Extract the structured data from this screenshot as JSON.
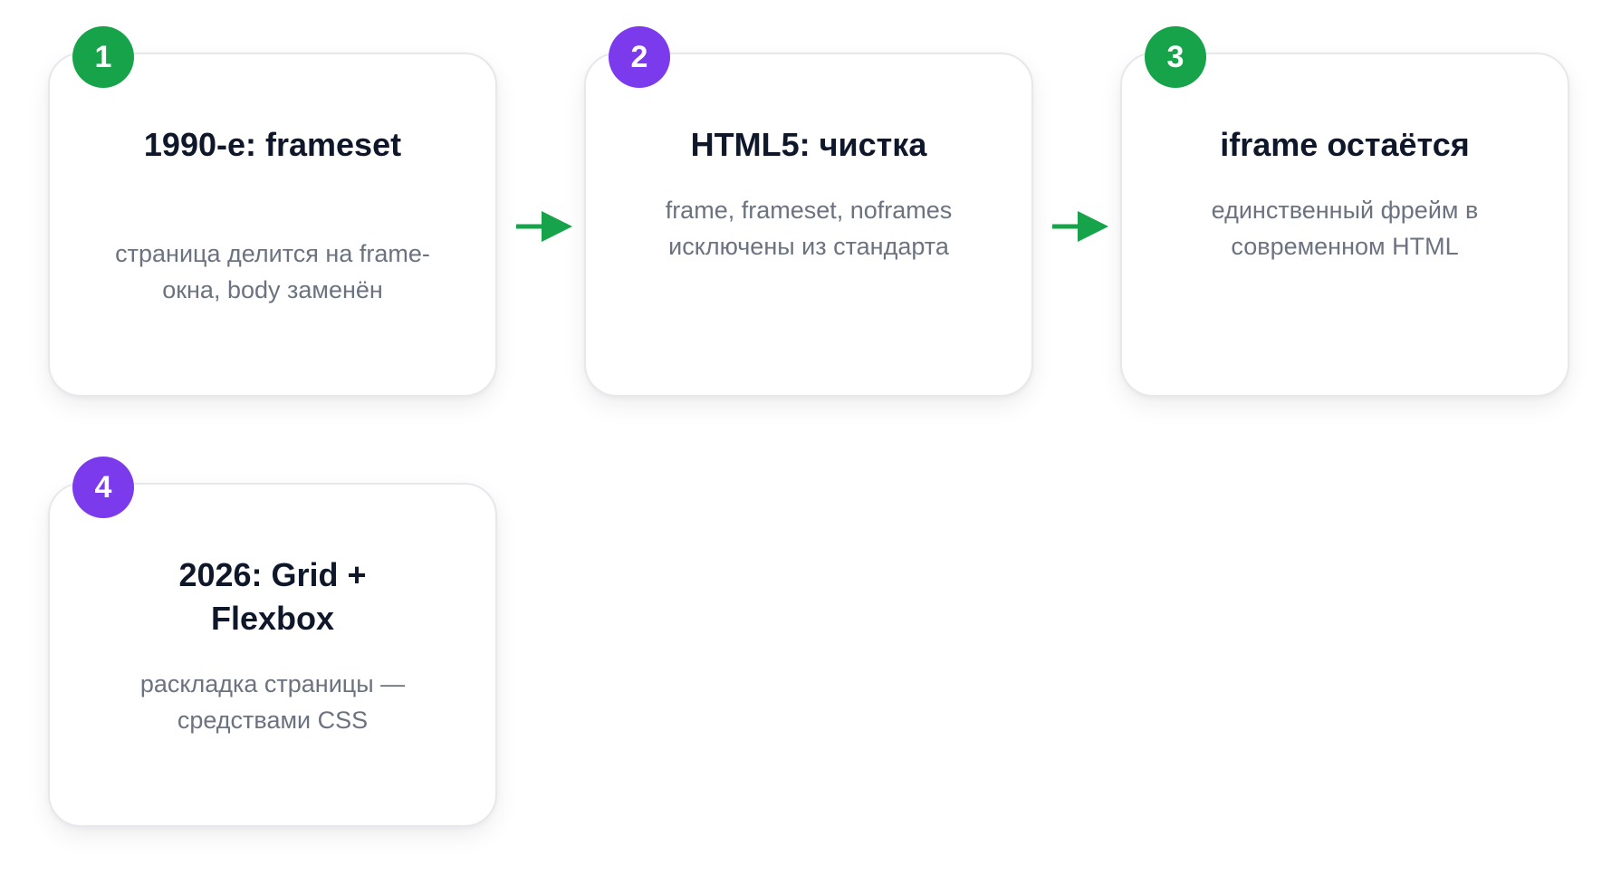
{
  "colors": {
    "green": "#16a34a",
    "purple": "#7c3aed",
    "arrow": "#16a34a"
  },
  "steps": [
    {
      "number": "1",
      "title": "1990-е: frameset",
      "description": "страница делится на frame-окна, body заменён",
      "badge_color": "#16a34a"
    },
    {
      "number": "2",
      "title": "HTML5: чистка",
      "description": "frame, frameset, noframes исключены из стандарта",
      "badge_color": "#7c3aed"
    },
    {
      "number": "3",
      "title": "iframe остаётся",
      "description": "единственный фрейм в современном HTML",
      "badge_color": "#16a34a"
    },
    {
      "number": "4",
      "title": "2026: Grid + Flexbox",
      "description": "раскладка страницы — средствами CSS",
      "badge_color": "#7c3aed"
    }
  ]
}
